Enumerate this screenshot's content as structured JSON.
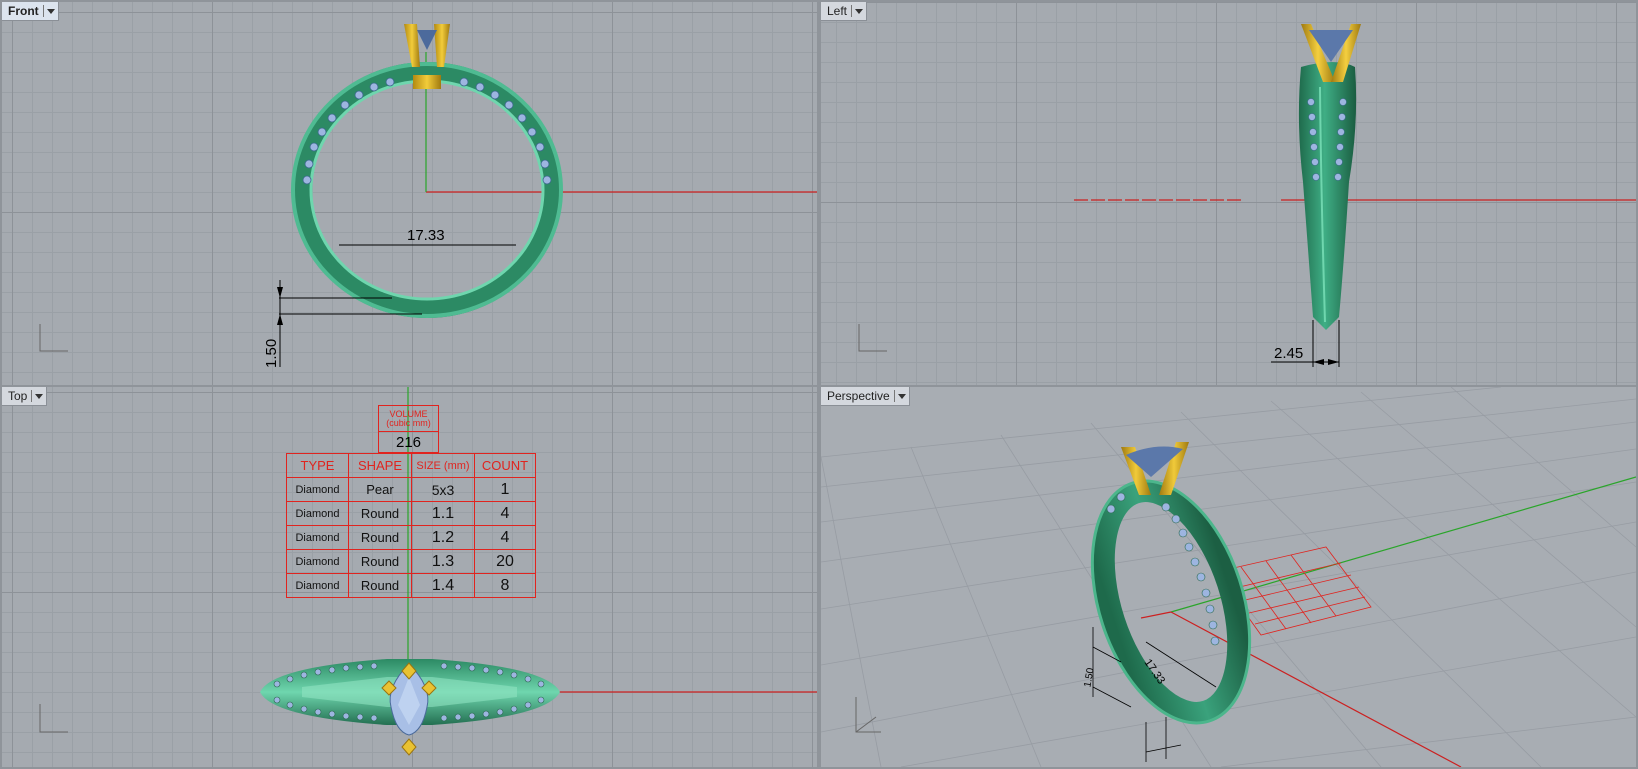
{
  "viewports": {
    "front": {
      "label": "Front",
      "dimension_width": "17.33",
      "dimension_height": "1.50"
    },
    "left": {
      "label": "Left",
      "dimension_width": "2.45"
    },
    "top": {
      "label": "Top"
    },
    "perspective": {
      "label": "Perspective",
      "dim_width": "17.33",
      "dim_height": "1.50"
    }
  },
  "volume": {
    "title": "VOLUME",
    "subtitle": "(cubic mm)",
    "value": "216"
  },
  "stone_table": {
    "headers": [
      "TYPE",
      "SHAPE",
      "SIZE (mm)",
      "COUNT"
    ],
    "rows": [
      [
        "Diamond",
        "Pear",
        "5x3",
        "1"
      ],
      [
        "Diamond",
        "Round",
        "1.1",
        "4"
      ],
      [
        "Diamond",
        "Round",
        "1.2",
        "4"
      ],
      [
        "Diamond",
        "Round",
        "1.3",
        "20"
      ],
      [
        "Diamond",
        "Round",
        "1.4",
        "8"
      ]
    ]
  },
  "colors": {
    "band": "#3aa27c",
    "prongs": "#e0b020",
    "stone": "#8aa4d8",
    "grid_bg": "#a5aab0",
    "axis_x": "#d02020",
    "axis_y": "#20a020",
    "table_border": "#e0241f"
  }
}
